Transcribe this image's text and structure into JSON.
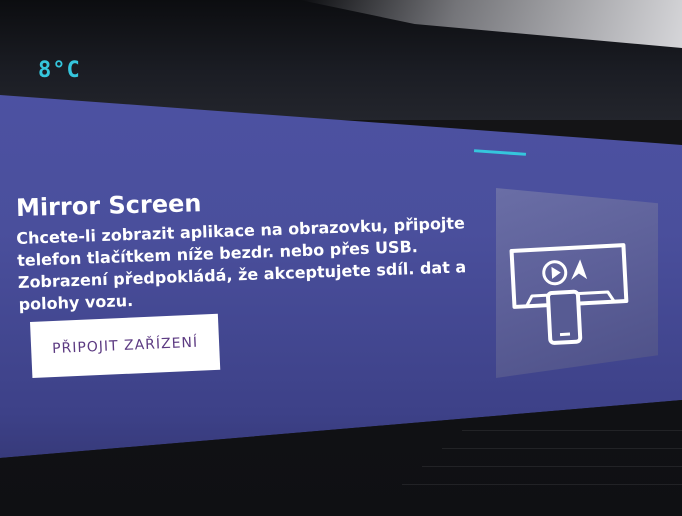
{
  "status_bar": {
    "temperature": "8°C"
  },
  "mirror_screen": {
    "title": "Mirror Screen",
    "description": "Chcete-li zobrazit aplikace na obrazovku, připojte telefon tlačítkem níže bezdr. nebo přes USB. Zobrazení předpokládá, že akceptujete sdíl. dat a polohy vozu.",
    "connect_button_label": "PŘIPOJIT ZAŘÍZENÍ",
    "illustration_icon": "phone-projection-icon"
  },
  "colors": {
    "screen_background": "#4a4f9c",
    "accent": "#35c6dd",
    "button_text": "#5c3a82"
  }
}
